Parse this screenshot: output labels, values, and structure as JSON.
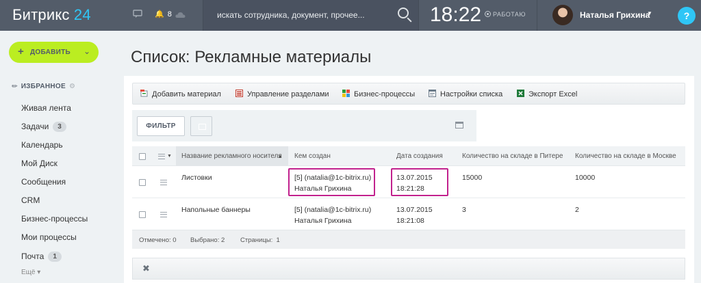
{
  "header": {
    "logo_main": "Битрикс",
    "logo_num": "24",
    "notification_count": "8",
    "search_placeholder": "искать сотрудника, документ, прочее...",
    "time": "18:22",
    "work_status": "РАБОТАЮ",
    "user_name": "Наталья Грихина",
    "help_label": "?"
  },
  "sidebar": {
    "add_button": "ДОБАВИТЬ",
    "favorites": "ИЗБРАННОЕ",
    "items": [
      {
        "label": "Живая лента",
        "count": ""
      },
      {
        "label": "Задачи",
        "count": "3"
      },
      {
        "label": "Календарь",
        "count": ""
      },
      {
        "label": "Мой Диск",
        "count": ""
      },
      {
        "label": "Сообщения",
        "count": ""
      },
      {
        "label": "CRM",
        "count": ""
      },
      {
        "label": "Бизнес-процессы",
        "count": ""
      },
      {
        "label": "Мои процессы",
        "count": ""
      },
      {
        "label": "Почта",
        "count": "1"
      }
    ],
    "more": "Ещё"
  },
  "page": {
    "title": "Список: Рекламные материалы"
  },
  "toolbar": {
    "add": "Добавить материал",
    "sections": "Управление разделами",
    "bp": "Бизнес-процессы",
    "settings": "Настройки списка",
    "excel": "Экспорт Excel"
  },
  "filter": {
    "button": "ФИЛЬТР"
  },
  "grid": {
    "columns": [
      "Название рекламного носителя",
      "Кем создан",
      "Дата создания",
      "Количество на складе в Питере",
      "Количество на складе в Москве"
    ],
    "rows": [
      {
        "name": "Листовки",
        "creator_1": "[5] (natalia@1c-bitrix.ru)",
        "creator_2": "Наталья Грихина",
        "date_1": "13.07.2015",
        "date_2": "18:21:28",
        "spb": "15000",
        "msk": "10000"
      },
      {
        "name": "Напольные баннеры",
        "creator_1": "[5] (natalia@1c-bitrix.ru)",
        "creator_2": "Наталья Грихина",
        "date_1": "13.07.2015",
        "date_2": "18:21:08",
        "spb": "3",
        "msk": "2"
      }
    ],
    "footer": {
      "marked_label": "Отмечено:",
      "marked": "0",
      "selected_label": "Выбрано:",
      "selected": "2",
      "pages_label": "Страницы:",
      "pages": "1"
    }
  },
  "colors": {
    "topbar": "#535c69",
    "accent": "#2fc6f6",
    "add_button": "#bbed21",
    "highlight": "#c1218d"
  }
}
